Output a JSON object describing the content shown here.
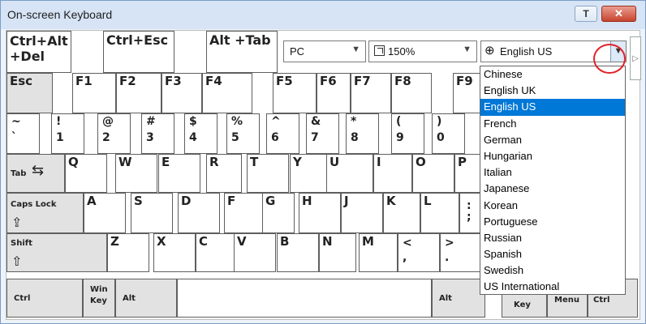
{
  "window": {
    "title": "On-screen Keyboard",
    "pin_label": "T",
    "close_label": "✕"
  },
  "toolbar": {
    "ctrl_alt_del": "Ctrl+Alt\n+Del",
    "ctrl_esc": "Ctrl+Esc",
    "alt_tab": "Alt +Tab",
    "layout_value": "PC",
    "zoom_value": "150%",
    "language_value": "English US"
  },
  "function_row": [
    "Esc",
    "F1",
    "F2",
    "F3",
    "F4",
    "F5",
    "F6",
    "F7",
    "F8",
    "F9"
  ],
  "number_row": [
    {
      "top": "~",
      "bottom": "`"
    },
    {
      "top": "!",
      "bottom": "1"
    },
    {
      "top": "@",
      "bottom": "2"
    },
    {
      "top": "#",
      "bottom": "3"
    },
    {
      "top": "$",
      "bottom": "4"
    },
    {
      "top": "%",
      "bottom": "5"
    },
    {
      "top": "^",
      "bottom": "6"
    },
    {
      "top": "&",
      "bottom": "7"
    },
    {
      "top": "*",
      "bottom": "8"
    },
    {
      "top": "(",
      "bottom": "9"
    },
    {
      "top": ")",
      "bottom": "0"
    }
  ],
  "qwerty_row": [
    "Q",
    "W",
    "E",
    "R",
    "T",
    "Y",
    "U",
    "I",
    "O",
    "P"
  ],
  "home_row": [
    "A",
    "S",
    "D",
    "F",
    "G",
    "H",
    "J",
    "K",
    "L"
  ],
  "shift_row": [
    "Z",
    "X",
    "C",
    "V",
    "B",
    "N",
    "M"
  ],
  "punct": {
    "comma": {
      "top": "<",
      "bottom": ","
    },
    "period": {
      "top": ">",
      "bottom": "."
    },
    "semicolon": {
      "top": ":",
      "bottom": ";"
    }
  },
  "modifiers": {
    "tab": "Tab",
    "caps_lock": "Caps Lock",
    "shift": "Shift",
    "ctrl_left": "Ctrl",
    "win_key": "Win\nKey",
    "alt_left": "Alt",
    "alt_right": "Alt",
    "key_right": "Key",
    "menu": "Menu",
    "ctrl_right": "Ctrl"
  },
  "language_options": [
    "Chinese",
    "English UK",
    "English US",
    "French",
    "German",
    "Hungarian",
    "Italian",
    "Japanese",
    "Korean",
    "Portuguese",
    "Russian",
    "Spanish",
    "Swedish",
    "US International"
  ],
  "selected_language": "English US",
  "icons": {
    "zoom": "zoom-icon",
    "globe": "globe-icon",
    "dropdown": "chevron-down-icon"
  },
  "colors": {
    "titlebar": "#d6e4f5",
    "selection": "#0078d7",
    "highlight_circle": "#e0232b",
    "close_button": "#c7452f"
  }
}
